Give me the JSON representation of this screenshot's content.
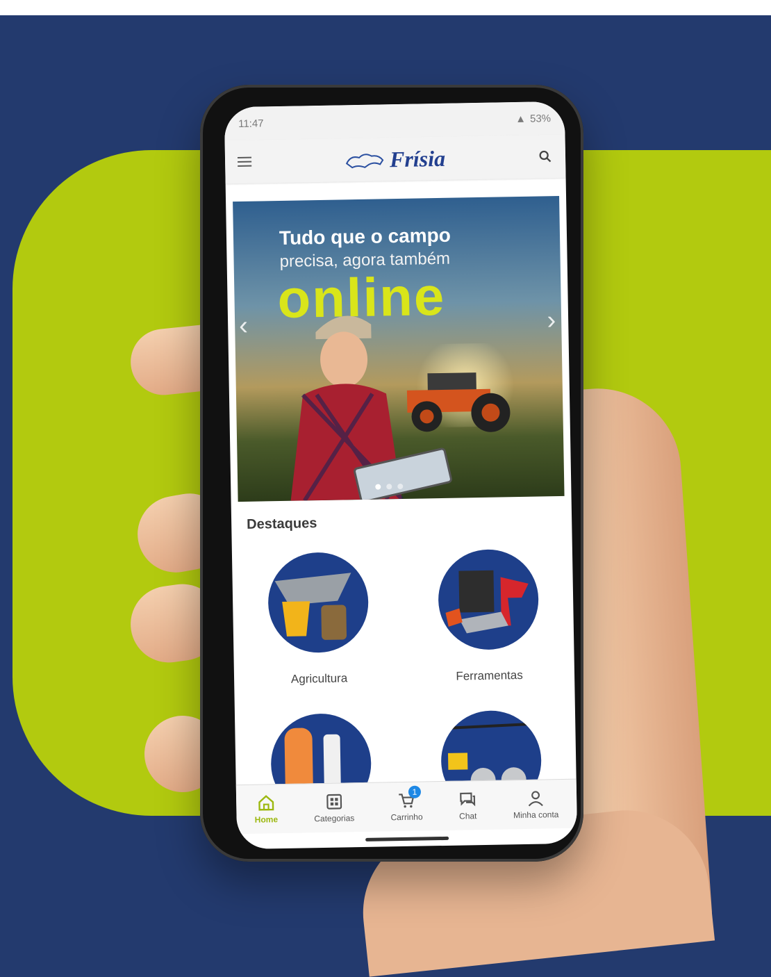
{
  "colors": {
    "background": "#233a6e",
    "accent_lime": "#b2ca0f",
    "brand_blue": "#223f8f",
    "nav_active": "#9cb80f",
    "badge": "#1e88e5"
  },
  "statusbar": {
    "time": "11:47",
    "battery": "53%"
  },
  "appbar": {
    "menu_icon": "hamburger-icon",
    "logo_text": "Frísia",
    "search_icon": "search-icon"
  },
  "banner": {
    "line1": "Tudo que o campo",
    "line2": "precisa, agora também",
    "line3": "online",
    "slide_count": 3,
    "active_slide": 1
  },
  "featured": {
    "title": "Destaques",
    "categories": [
      {
        "label": "Agricultura"
      },
      {
        "label": "Ferramentas"
      },
      {
        "label": ""
      },
      {
        "label": ""
      }
    ]
  },
  "bottom_nav": {
    "items": [
      {
        "label": "Home",
        "icon": "home-icon",
        "active": true
      },
      {
        "label": "Categorias",
        "icon": "grid-icon",
        "active": false
      },
      {
        "label": "Carrinho",
        "icon": "cart-icon",
        "active": false,
        "badge": "1"
      },
      {
        "label": "Chat",
        "icon": "chat-icon",
        "active": false
      },
      {
        "label": "Minha conta",
        "icon": "user-icon",
        "active": false
      }
    ]
  }
}
